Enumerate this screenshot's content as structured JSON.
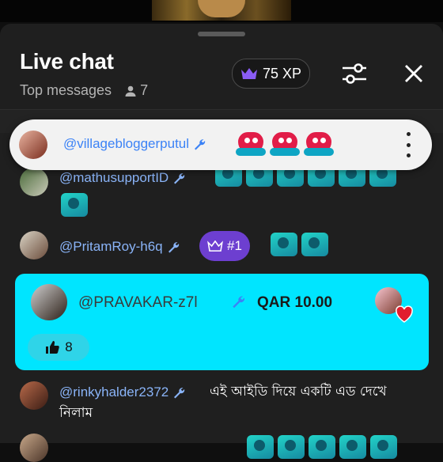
{
  "header": {
    "title": "Live chat",
    "subtitle": "Top messages",
    "viewer_count": "7",
    "xp_label": "75 XP"
  },
  "pinned": {
    "username": "@villagebloggerputul",
    "emoji": [
      "heart-face-emoji",
      "heart-face-emoji",
      "heart-face-emoji"
    ]
  },
  "messages": [
    {
      "username": "@mathusupportID",
      "emoji_count": 7
    },
    {
      "username": "@PritamRoy-h6q",
      "rank": "#1",
      "emoji_count": 2
    },
    {
      "username": "@rinkyhalder2372",
      "text": "এই আইডি দিয়ে একটি এড দেখে নিলাম"
    }
  ],
  "super_chat": {
    "username": "@PRAVAKAR-z7l",
    "amount": "QAR 10.00",
    "likes": "8"
  },
  "colors": {
    "background": "#1f1f1f",
    "username": "#8ab4f8",
    "super_chat_bg": "#00e5ff",
    "rank_pill": "#6d3fd0"
  }
}
